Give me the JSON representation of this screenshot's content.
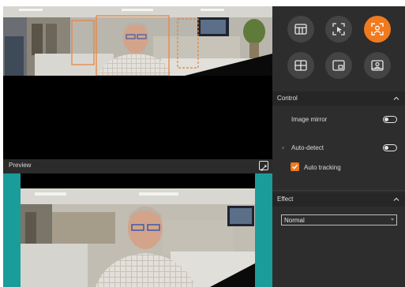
{
  "layout_buttons": [
    {
      "icon": "grid-three-panel-icon",
      "active": false
    },
    {
      "icon": "select-region-icon",
      "active": false
    },
    {
      "icon": "auto-frame-person-icon",
      "active": true
    },
    {
      "icon": "quad-grid-icon",
      "active": false
    },
    {
      "icon": "picture-in-picture-icon",
      "active": false
    },
    {
      "icon": "presenter-view-icon",
      "active": false
    }
  ],
  "preview": {
    "label": "Preview"
  },
  "control": {
    "title": "Control",
    "image_mirror_label": "Image mirror",
    "image_mirror_on": false,
    "auto_detect_label": "Auto-detect",
    "auto_detect_on": false,
    "auto_tracking_label": "Auto tracking",
    "auto_tracking_checked": true
  },
  "effect": {
    "title": "Effect",
    "selected": "Normal"
  },
  "colors": {
    "accent": "#f07a1e",
    "panel_bg": "#2d2d2d",
    "teal": "#1a9d9a",
    "overlay_box": "#e8813a"
  }
}
